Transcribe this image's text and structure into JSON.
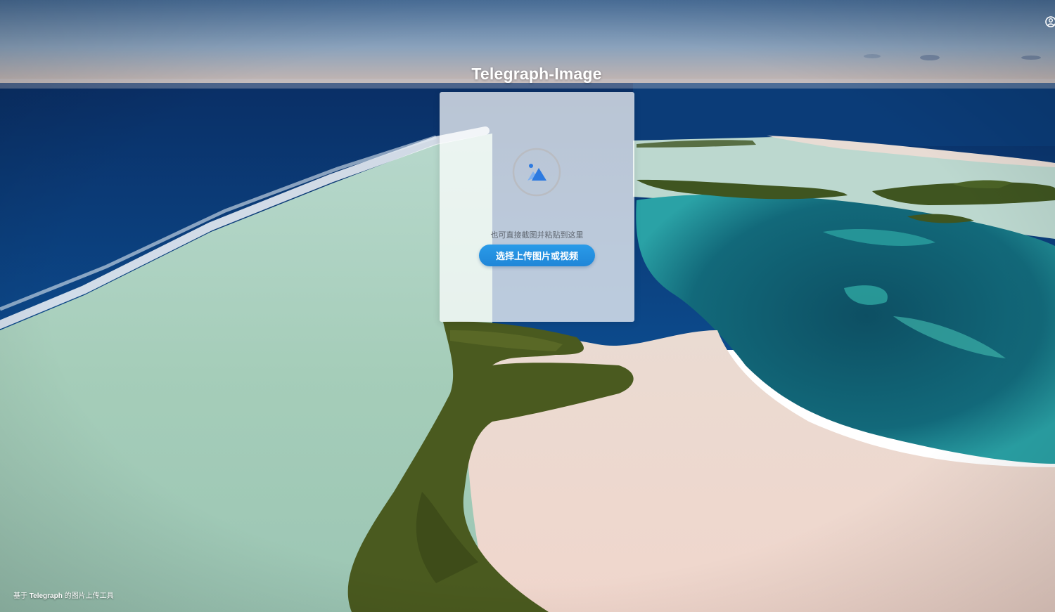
{
  "app": {
    "title": "Telegraph-Image"
  },
  "upload": {
    "icon": "image-upload-icon",
    "hint": "也可直接截图并粘贴到这里",
    "button_label": "选择上传图片或视频"
  },
  "footer": {
    "prefix": "基于",
    "brand": "Telegraph",
    "suffix": "的图片上传工具"
  },
  "corner": {
    "icon": "user-icon"
  },
  "colors": {
    "accent": "#1f86d8",
    "ocean_deep": "#0d3a7a",
    "lagoon": "#1f8aa0",
    "sand": "#eed9cf",
    "shallow": "#a9d2c0"
  }
}
